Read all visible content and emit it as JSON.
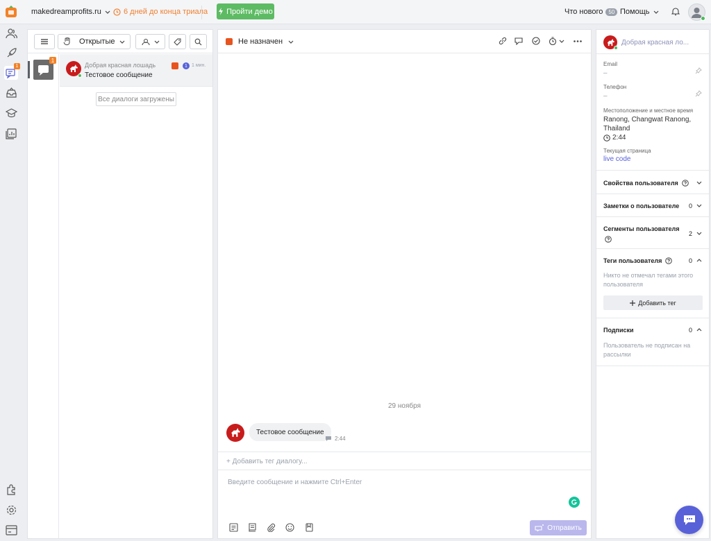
{
  "topbar": {
    "site": "makedreamprofits.ru",
    "trial": "6 дней до конца триала",
    "demo": "Пройти демо",
    "whats_new": "Что нового",
    "whats_new_count": "50",
    "help": "Помощь"
  },
  "nav": {
    "conversations_badge": "1"
  },
  "list_panel": {
    "filter": "Открытые",
    "channel_badge": "1",
    "conversation": {
      "name": "Добрая красная лошадь",
      "message": "Тестовое сообщение",
      "unread": "1",
      "time": "1 мин."
    },
    "all_loaded": "Все диалоги загружены"
  },
  "chat_panel": {
    "assignee": "Не назначен",
    "date": "29 ноября",
    "message": "Тестовое сообщение",
    "message_time": "2:44",
    "add_tag": "+ Добавить тег диалогу...",
    "compose_placeholder": "Введите сообщение и нажмите Ctrl+Enter",
    "send": "Отправить"
  },
  "user_panel": {
    "name": "Добрая красная ло...",
    "email_label": "Email",
    "email_value": "–",
    "phone_label": "Телефон",
    "phone_value": "–",
    "location_label": "Местоположение и местное время",
    "location_value": "Ranong, Changwat Ranong, Thailand",
    "local_time": "2:44",
    "page_label": "Текущая страница",
    "page_value": "live code",
    "sections": {
      "props": "Свойства пользователя",
      "notes": "Заметки о пользователе",
      "notes_count": "0",
      "segments": "Сегменты пользователя",
      "segments_count": "2",
      "tags": "Теги пользователя",
      "tags_count": "0",
      "tags_empty": "Никто не отмечал тегами этого пользователя",
      "add_tag": "Добавить тег",
      "subs": "Подписки",
      "subs_count": "0",
      "subs_empty": "Пользователь не подписан на рассылки"
    }
  },
  "colors": {
    "accent": "#5961d8",
    "demo_green": "#5dbb63",
    "trial_orange": "#f0802f",
    "avatar_red": "#c81c1c"
  }
}
